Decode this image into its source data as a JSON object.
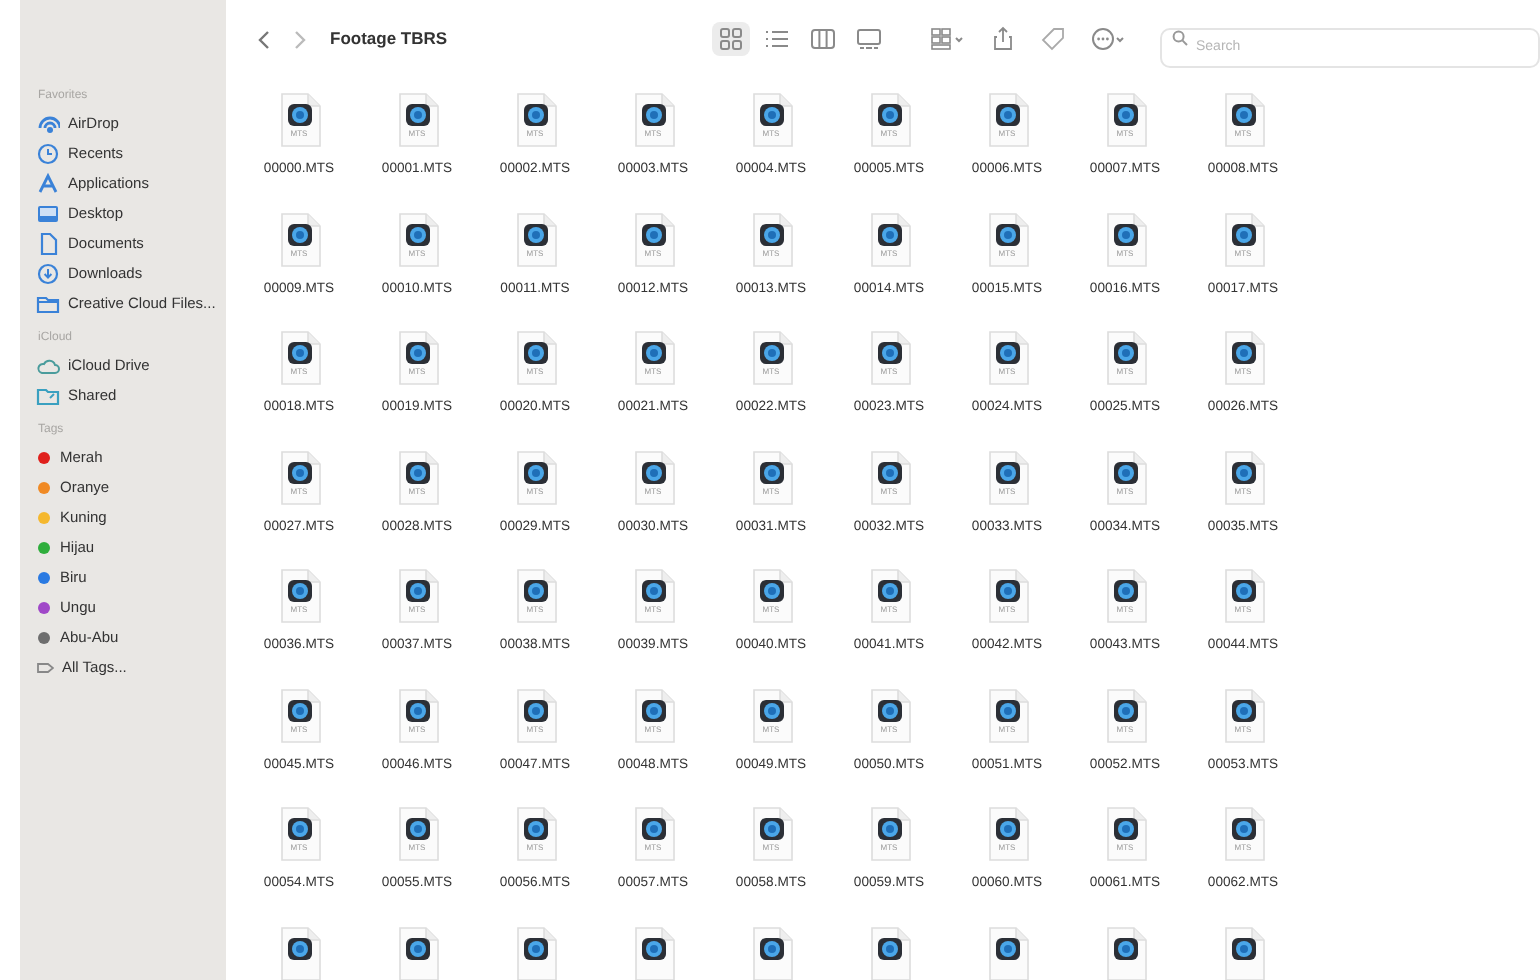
{
  "window": {
    "title": "Footage TBRS"
  },
  "sidebar": {
    "sections": [
      {
        "title": "Favorites",
        "items": [
          {
            "label": "AirDrop"
          },
          {
            "label": "Recents"
          },
          {
            "label": "Applications"
          },
          {
            "label": "Desktop"
          },
          {
            "label": "Documents"
          },
          {
            "label": "Downloads"
          },
          {
            "label": "Creative Cloud Files..."
          }
        ]
      },
      {
        "title": "iCloud",
        "items": [
          {
            "label": "iCloud Drive"
          },
          {
            "label": "Shared"
          }
        ]
      },
      {
        "title": "Tags",
        "items": [
          {
            "label": "Merah",
            "kind": "tag",
            "color": "#e0201c"
          },
          {
            "label": "Oranye",
            "kind": "tag",
            "color": "#f08a24"
          },
          {
            "label": "Kuning",
            "kind": "tag",
            "color": "#f5b82e"
          },
          {
            "label": "Hijau",
            "kind": "tag",
            "color": "#2fae3c"
          },
          {
            "label": "Biru",
            "kind": "tag",
            "color": "#2a7ae2"
          },
          {
            "label": "Ungu",
            "kind": "tag",
            "color": "#a048c8"
          },
          {
            "label": "Abu-Abu",
            "kind": "tag",
            "color": "#6e6e6e"
          },
          {
            "label": "All Tags...",
            "kind": "all"
          }
        ]
      }
    ]
  },
  "toolbar": {
    "views": [
      {
        "selected": true
      },
      {
        "selected": false
      },
      {
        "selected": false
      },
      {
        "selected": false
      }
    ],
    "search": {
      "placeholder": "Search"
    }
  },
  "files": [
    {
      "kind": "file",
      "name": "00000.MTS",
      "icon_label": "MTS"
    },
    {
      "kind": "file",
      "name": "00001.MTS",
      "icon_label": "MTS"
    },
    {
      "kind": "file",
      "name": "00002.MTS",
      "icon_label": "MTS"
    },
    {
      "kind": "file",
      "name": "00003.MTS",
      "icon_label": "MTS"
    },
    {
      "kind": "file",
      "name": "00004.MTS",
      "icon_label": "MTS"
    },
    {
      "kind": "file",
      "name": "00005.MTS",
      "icon_label": "MTS"
    },
    {
      "kind": "file",
      "name": "00006.MTS",
      "icon_label": "MTS"
    },
    {
      "kind": "file",
      "name": "00007.MTS",
      "icon_label": "MTS"
    },
    {
      "kind": "file",
      "name": "00008.MTS",
      "icon_label": "MTS"
    },
    {
      "kind": "file",
      "name": "00009.MTS",
      "icon_label": "MTS"
    },
    {
      "kind": "file",
      "name": "00010.MTS",
      "icon_label": "MTS"
    },
    {
      "kind": "file",
      "name": "00011.MTS",
      "icon_label": "MTS"
    },
    {
      "kind": "file",
      "name": "00012.MTS",
      "icon_label": "MTS"
    },
    {
      "kind": "file",
      "name": "00013.MTS",
      "icon_label": "MTS"
    },
    {
      "kind": "file",
      "name": "00014.MTS",
      "icon_label": "MTS"
    },
    {
      "kind": "file",
      "name": "00015.MTS",
      "icon_label": "MTS"
    },
    {
      "kind": "file",
      "name": "00016.MTS",
      "icon_label": "MTS"
    },
    {
      "kind": "file",
      "name": "00017.MTS",
      "icon_label": "MTS"
    },
    {
      "kind": "file",
      "name": "00018.MTS",
      "icon_label": "MTS"
    },
    {
      "kind": "file",
      "name": "00019.MTS",
      "icon_label": "MTS"
    },
    {
      "kind": "file",
      "name": "00020.MTS",
      "icon_label": "MTS"
    },
    {
      "kind": "file",
      "name": "00021.MTS",
      "icon_label": "MTS"
    },
    {
      "kind": "file",
      "name": "00022.MTS",
      "icon_label": "MTS"
    },
    {
      "kind": "file",
      "name": "00023.MTS",
      "icon_label": "MTS"
    },
    {
      "kind": "file",
      "name": "00024.MTS",
      "icon_label": "MTS"
    },
    {
      "kind": "file",
      "name": "00025.MTS",
      "icon_label": "MTS"
    },
    {
      "kind": "file",
      "name": "00026.MTS",
      "icon_label": "MTS"
    },
    {
      "kind": "file",
      "name": "00027.MTS",
      "icon_label": "MTS"
    },
    {
      "kind": "file",
      "name": "00028.MTS",
      "icon_label": "MTS"
    },
    {
      "kind": "file",
      "name": "00029.MTS",
      "icon_label": "MTS"
    },
    {
      "kind": "file",
      "name": "00030.MTS",
      "icon_label": "MTS"
    },
    {
      "kind": "file",
      "name": "00031.MTS",
      "icon_label": "MTS"
    },
    {
      "kind": "file",
      "name": "00032.MTS",
      "icon_label": "MTS"
    },
    {
      "kind": "file",
      "name": "00033.MTS",
      "icon_label": "MTS"
    },
    {
      "kind": "file",
      "name": "00034.MTS",
      "icon_label": "MTS"
    },
    {
      "kind": "file",
      "name": "00035.MTS",
      "icon_label": "MTS"
    },
    {
      "kind": "file",
      "name": "00036.MTS",
      "icon_label": "MTS"
    },
    {
      "kind": "file",
      "name": "00037.MTS",
      "icon_label": "MTS"
    },
    {
      "kind": "file",
      "name": "00038.MTS",
      "icon_label": "MTS"
    },
    {
      "kind": "file",
      "name": "00039.MTS",
      "icon_label": "MTS"
    },
    {
      "kind": "file",
      "name": "00040.MTS",
      "icon_label": "MTS"
    },
    {
      "kind": "file",
      "name": "00041.MTS",
      "icon_label": "MTS"
    },
    {
      "kind": "file",
      "name": "00042.MTS",
      "icon_label": "MTS"
    },
    {
      "kind": "file",
      "name": "00043.MTS",
      "icon_label": "MTS"
    },
    {
      "kind": "file",
      "name": "00044.MTS",
      "icon_label": "MTS"
    },
    {
      "kind": "file",
      "name": "00045.MTS",
      "icon_label": "MTS"
    },
    {
      "kind": "file",
      "name": "00046.MTS",
      "icon_label": "MTS"
    },
    {
      "kind": "file",
      "name": "00047.MTS",
      "icon_label": "MTS"
    },
    {
      "kind": "file",
      "name": "00048.MTS",
      "icon_label": "MTS"
    },
    {
      "kind": "file",
      "name": "00049.MTS",
      "icon_label": "MTS"
    },
    {
      "kind": "file",
      "name": "00050.MTS",
      "icon_label": "MTS"
    },
    {
      "kind": "file",
      "name": "00051.MTS",
      "icon_label": "MTS"
    },
    {
      "kind": "file",
      "name": "00052.MTS",
      "icon_label": "MTS"
    },
    {
      "kind": "file",
      "name": "00053.MTS",
      "icon_label": "MTS"
    },
    {
      "kind": "file",
      "name": "00054.MTS",
      "icon_label": "MTS"
    },
    {
      "kind": "file",
      "name": "00055.MTS",
      "icon_label": "MTS"
    },
    {
      "kind": "file",
      "name": "00056.MTS",
      "icon_label": "MTS"
    },
    {
      "kind": "file",
      "name": "00057.MTS",
      "icon_label": "MTS"
    },
    {
      "kind": "file",
      "name": "00058.MTS",
      "icon_label": "MTS"
    },
    {
      "kind": "file",
      "name": "00059.MTS",
      "icon_label": "MTS"
    },
    {
      "kind": "file",
      "name": "00060.MTS",
      "icon_label": "MTS"
    },
    {
      "kind": "file",
      "name": "00061.MTS",
      "icon_label": "MTS"
    },
    {
      "kind": "file",
      "name": "00062.MTS",
      "icon_label": "MTS"
    },
    {
      "kind": "cut"
    },
    {
      "kind": "cut"
    },
    {
      "kind": "cut"
    },
    {
      "kind": "cut"
    },
    {
      "kind": "cut"
    },
    {
      "kind": "cut"
    },
    {
      "kind": "cut"
    },
    {
      "kind": "cut"
    },
    {
      "kind": "cut"
    }
  ]
}
